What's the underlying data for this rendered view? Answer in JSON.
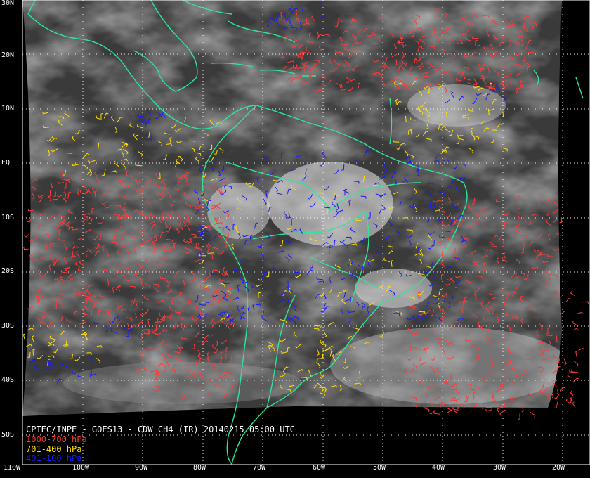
{
  "caption": {
    "title": "CPTEC/INPE - GOES13 - CDW CH4 (IR) 20140215 05:00 UTC",
    "layers": [
      {
        "label": "1000-700 hPa",
        "color": "#ff3a3a"
      },
      {
        "label": "701-400 hPa",
        "color": "#ffe000"
      },
      {
        "label": "401-100 hPa",
        "color": "#1a1aff"
      }
    ]
  },
  "latitude_labels": [
    "30N",
    "20N",
    "10N",
    "EQ",
    "10S",
    "20S",
    "30S",
    "40S",
    "50S"
  ],
  "longitude_labels": [
    "110W",
    "100W",
    "90W",
    "80W",
    "70W",
    "60W",
    "50W",
    "40W",
    "30W",
    "20W"
  ],
  "colors": {
    "coastline": "#2ee59a",
    "grid": "#ffffff",
    "background": "#000000",
    "cloud_dark": "#3a3a3a"
  }
}
